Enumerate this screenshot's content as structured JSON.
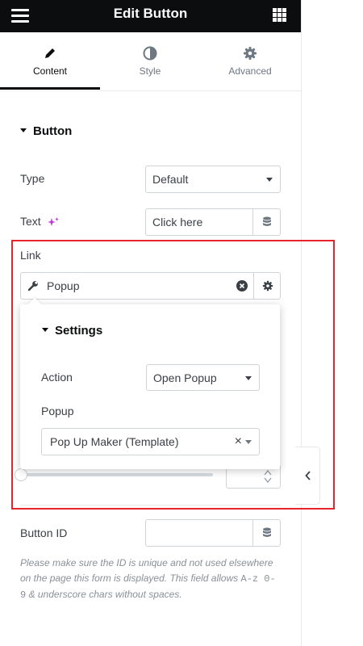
{
  "header": {
    "title": "Edit Button",
    "menu_icon": "hamburger-icon",
    "grid_icon": "apps-grid-icon"
  },
  "tabs": [
    {
      "label": "Content",
      "icon": "pencil-icon",
      "active": true
    },
    {
      "label": "Style",
      "icon": "contrast-icon",
      "active": false
    },
    {
      "label": "Advanced",
      "icon": "gear-icon",
      "active": false
    }
  ],
  "section": {
    "title": "Button"
  },
  "fields": {
    "type": {
      "label": "Type",
      "value": "Default"
    },
    "text": {
      "label": "Text",
      "value": "Click here"
    },
    "link": {
      "label": "Link",
      "value": "Popup"
    },
    "button_id": {
      "label": "Button ID",
      "value": ""
    }
  },
  "settings": {
    "title": "Settings",
    "action": {
      "label": "Action",
      "value": "Open Popup"
    },
    "popup": {
      "label": "Popup",
      "value": "Pop Up Maker (Template)",
      "clear": "×"
    }
  },
  "helper": {
    "text_before": "Please make sure the ID is unique and not used elsewhere on the page this form is displayed. This field allows ",
    "code": "A-z 0-9",
    "text_after": " & underscore chars without spaces."
  },
  "colors": {
    "topbar": "#0c0d0e",
    "highlight": "#e5242b",
    "ai_sparkle": "#c233e0"
  }
}
